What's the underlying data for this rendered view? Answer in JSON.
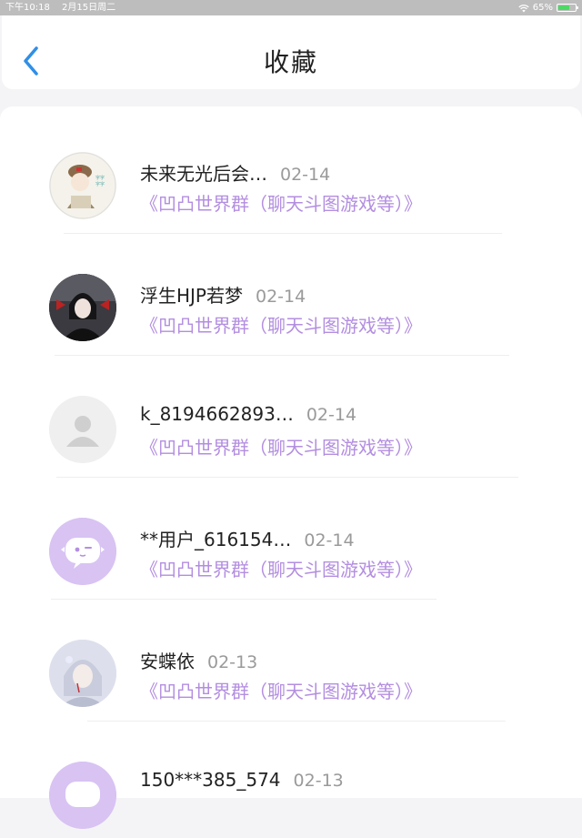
{
  "status_bar": {
    "time": "下午10:18",
    "date": "2月15日周二",
    "battery": "65%",
    "battery_level": 0.65
  },
  "header": {
    "title": "收藏"
  },
  "items": [
    {
      "name": "未来无光后会…",
      "date": "02-14",
      "group": "《凹凸世界群（聊天斗图游戏等）》",
      "avatar": "anime-figure-avatar"
    },
    {
      "name": "浮生HJP若梦",
      "date": "02-14",
      "group": "《凹凸世界群（聊天斗图游戏等）》",
      "avatar": "dark-anime-avatar"
    },
    {
      "name": "k_8194662893…",
      "date": "02-14",
      "group": "《凹凸世界群（聊天斗图游戏等）》",
      "avatar": "default-user-avatar"
    },
    {
      "name": "**用户_616154…",
      "date": "02-14",
      "group": "《凹凸世界群（聊天斗图游戏等）》",
      "avatar": "chat-bubble-avatar"
    },
    {
      "name": "安蝶依",
      "date": "02-13",
      "group": "《凹凸世界群（聊天斗图游戏等）》",
      "avatar": "pastel-anime-avatar"
    },
    {
      "name": "150***385_574",
      "date": "02-13",
      "group": "",
      "avatar": "chat-bubble-avatar"
    }
  ]
}
